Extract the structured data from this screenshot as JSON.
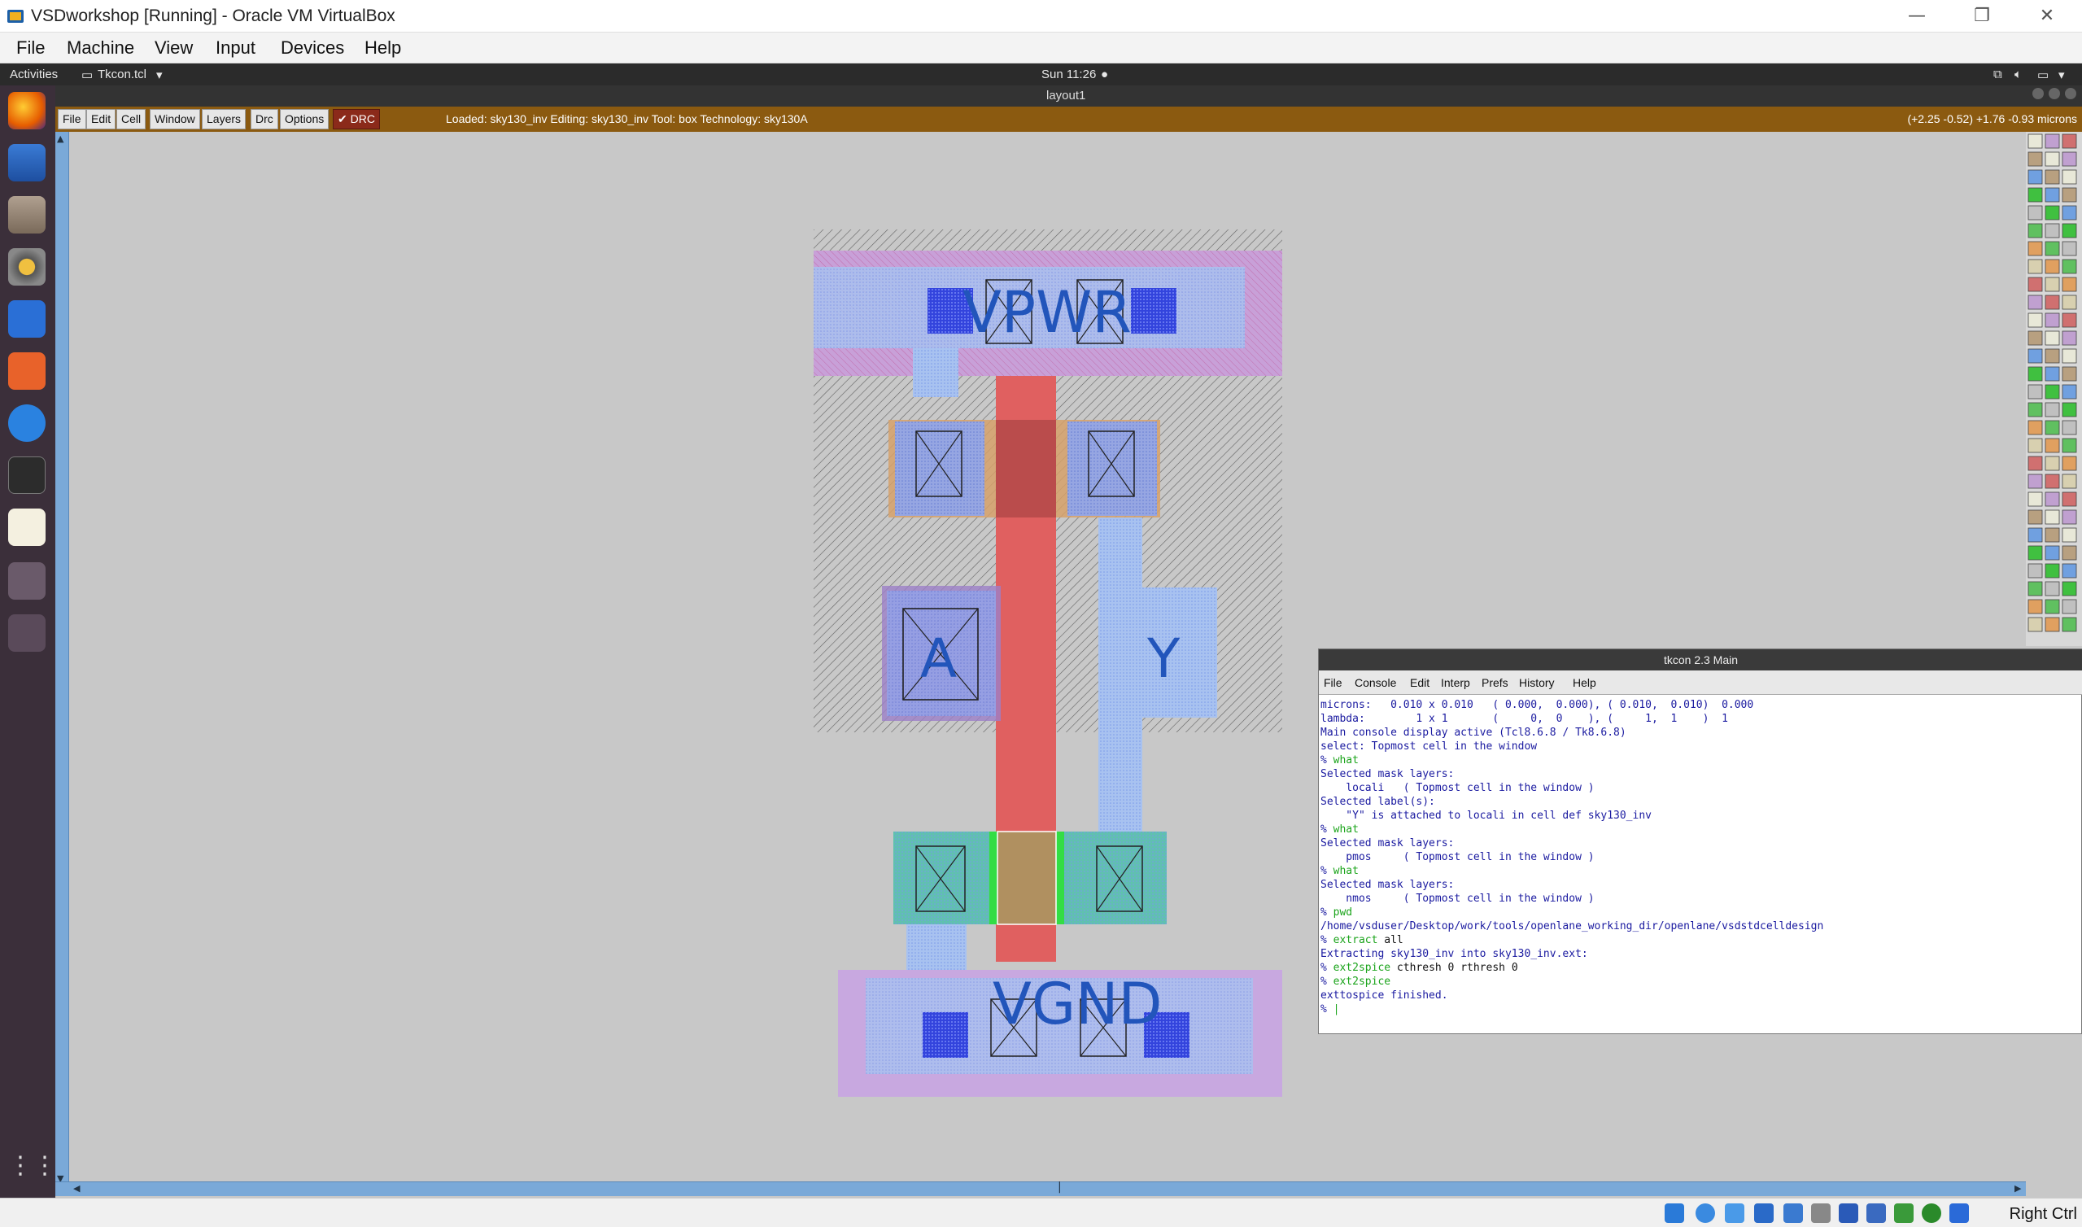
{
  "host": {
    "title": "VSDworkshop [Running] - Oracle VM VirtualBox",
    "minimize": "—",
    "restore": "❐",
    "close": "✕"
  },
  "vbox_menu": [
    "File",
    "Machine",
    "View",
    "Input",
    "Devices",
    "Help"
  ],
  "gnome": {
    "activities": "Activities",
    "app": "Tkcon.tcl",
    "clock": "Sun 11:26",
    "window_title": "layout1"
  },
  "magic": {
    "buttons": [
      "File",
      "Edit",
      "Cell",
      "Window",
      "Layers",
      "Drc",
      "Options"
    ],
    "drc_label": "DRC",
    "status": "Loaded: sky130_inv Editing: sky130_inv Tool: box  Technology: sky130A",
    "coords": "(+2.25 -0.52) +1.76 -0.93 microns"
  },
  "labels": {
    "vpwr": "VPWR",
    "vgnd": "VGND",
    "a": "A",
    "y": "Y"
  },
  "tkcon": {
    "title": "tkcon 2.3 Main",
    "menu": [
      "File",
      "Console",
      "Edit",
      "Interp",
      "Prefs",
      "History",
      "Help"
    ],
    "lines": [
      {
        "type": "out",
        "text": "microns:   0.010 x 0.010   ( 0.000,  0.000), ( 0.010,  0.010)  0.000"
      },
      {
        "type": "out",
        "text": "lambda:        1 x 1       (     0,  0    ), (     1,  1    )  1"
      },
      {
        "type": "out",
        "text": "Main console display active (Tcl8.6.8 / Tk8.6.8)"
      },
      {
        "type": "out",
        "text": "select: Topmost cell in the window"
      },
      {
        "type": "cmd",
        "prompt": "% ",
        "text": "what"
      },
      {
        "type": "out",
        "text": "Selected mask layers:"
      },
      {
        "type": "out",
        "text": "    locali   ( Topmost cell in the window )"
      },
      {
        "type": "out",
        "text": "Selected label(s):"
      },
      {
        "type": "out",
        "text": "    \"Y\" is attached to locali in cell def sky130_inv"
      },
      {
        "type": "cmd",
        "prompt": "% ",
        "text": "what"
      },
      {
        "type": "out",
        "text": "Selected mask layers:"
      },
      {
        "type": "out",
        "text": "    pmos     ( Topmost cell in the window )"
      },
      {
        "type": "cmd",
        "prompt": "% ",
        "text": "what"
      },
      {
        "type": "out",
        "text": "Selected mask layers:"
      },
      {
        "type": "out",
        "text": "    nmos     ( Topmost cell in the window )"
      },
      {
        "type": "cmd",
        "prompt": "% ",
        "text": "pwd"
      },
      {
        "type": "out",
        "text": "/home/vsduser/Desktop/work/tools/openlane_working_dir/openlane/vsdstdcelldesign"
      },
      {
        "type": "cmd",
        "prompt": "% ",
        "text": "extract",
        "arg": " all"
      },
      {
        "type": "out",
        "text": "Extracting sky130_inv into sky130_inv.ext:"
      },
      {
        "type": "cmd",
        "prompt": "% ",
        "text": "ext2spice",
        "arg": " cthresh 0 rthresh 0"
      },
      {
        "type": "cmd",
        "prompt": "% ",
        "text": "ext2spice"
      },
      {
        "type": "out",
        "text": "exttospice finished."
      },
      {
        "type": "cmd",
        "prompt": "% ",
        "text": "|"
      }
    ]
  },
  "taskbar": {
    "right_ctrl": "Right Ctrl"
  },
  "colors": {
    "magic_bar": "#8b5a10",
    "canvas": "#c8c8c8",
    "poly": "#e06060",
    "locali": "#7799ee",
    "nwell": "#a070b0",
    "diff": "#d4a56a"
  }
}
